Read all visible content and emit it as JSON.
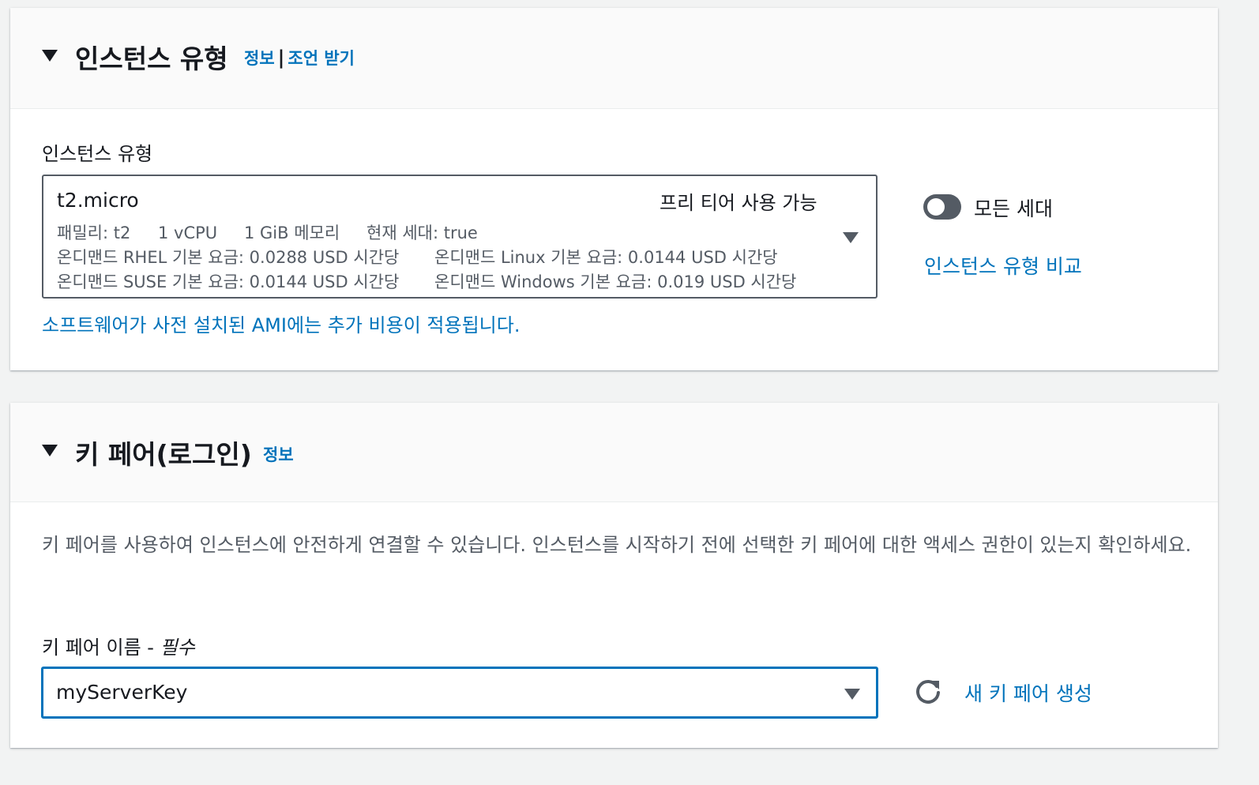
{
  "instance_type_panel": {
    "title": "인스턴스 유형",
    "info_link": "정보",
    "separator": "|",
    "advice_link": "조언 받기",
    "field_label": "인스턴스 유형",
    "selected": {
      "name": "t2.micro",
      "badge": "프리 티어 사용 가능",
      "family": "패밀리: t2",
      "vcpu": "1 vCPU",
      "memory": "1 GiB 메모리",
      "current_gen": "현재 세대: true",
      "rhel_price": "온디맨드 RHEL 기본 요금: 0.0288 USD 시간당",
      "linux_price": "온디맨드 Linux 기본 요금: 0.0144 USD 시간당",
      "suse_price": "온디맨드 SUSE 기본 요금: 0.0144 USD 시간당",
      "windows_price": "온디맨드 Windows 기본 요금: 0.019 USD 시간당"
    },
    "ami_note": "소프트웨어가 사전 설치된 AMI에는 추가 비용이 적용됩니다.",
    "toggle_label": "모든 세대",
    "toggle_on": false,
    "compare_link": "인스턴스 유형 비교"
  },
  "key_pair_panel": {
    "title": "키 페어(로그인)",
    "info_link": "정보",
    "description": "키 페어를 사용하여 인스턴스에 안전하게 연결할 수 있습니다. 인스턴스를 시작하기 전에 선택한 키 페어에 대한 액세스 권한이 있는지 확인하세요.",
    "field_label": "키 페어 이름 - ",
    "field_required": "필수",
    "selected_key": "myServerKey",
    "create_link": "새 키 페어 생성"
  },
  "colors": {
    "link": "#0073bb",
    "text": "#16191f",
    "secondary_text": "#545b64",
    "focus_border": "#0073bb",
    "toggle_off": "#545b64"
  }
}
